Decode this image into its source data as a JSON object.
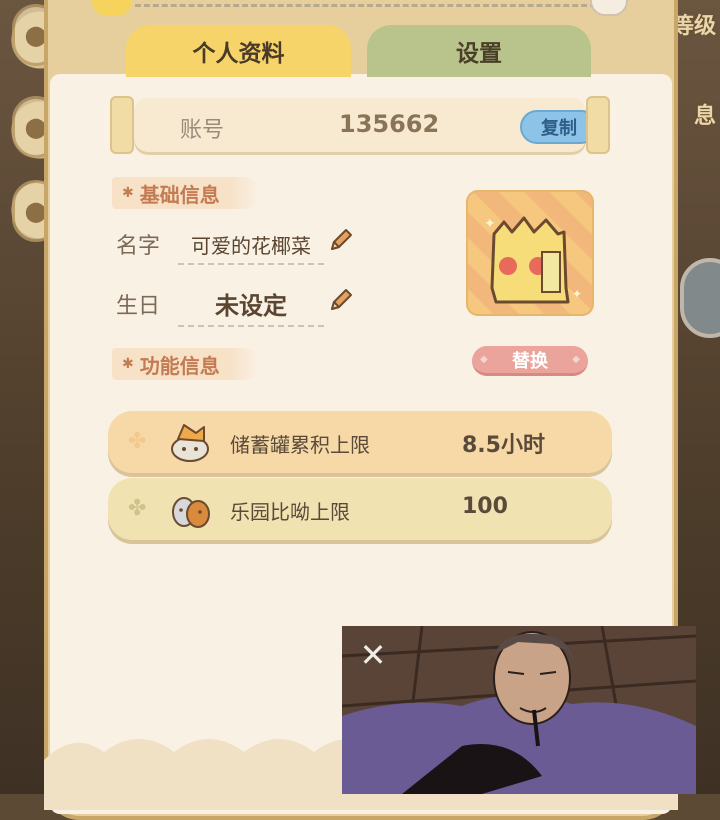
{
  "side_right": {
    "top_label": "等级",
    "bottom_label": "息"
  },
  "tabs": [
    {
      "label": "个人资料",
      "active": true
    },
    {
      "label": "设置",
      "active": false
    }
  ],
  "account": {
    "label": "账号",
    "value": "135662",
    "copy_label": "复制"
  },
  "basic_info": {
    "title": "基础信息",
    "name_label": "名字",
    "name_value": "可爱的花椰菜",
    "birthday_label": "生日",
    "birthday_value": "未设定"
  },
  "avatar": {
    "replace_label": "替换"
  },
  "feature_info": {
    "title": "功能信息",
    "rows": [
      {
        "label": "储蓄罐累积上限",
        "value": "8.5小时"
      },
      {
        "label": "乐园比呦上限",
        "value": "100"
      }
    ]
  },
  "colors": {
    "tab_active": "#f6d46a",
    "tab_inactive": "#b9c48c",
    "panel_bg": "#faf1e5",
    "copy_button": "#8cc3e6",
    "replace_button": "#eaa49b",
    "section_title": "#c47b52"
  },
  "icons": [
    "pencil-icon",
    "clover-icon",
    "close-icon"
  ]
}
